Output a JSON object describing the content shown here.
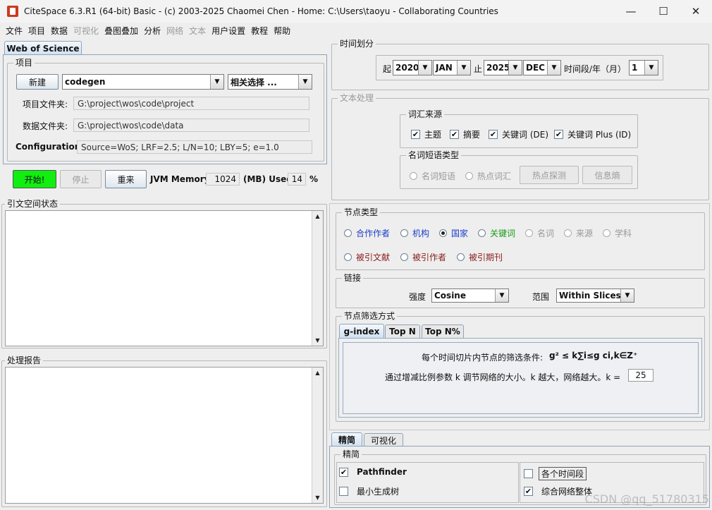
{
  "window": {
    "title": "CiteSpace 6.3.R1 (64-bit) Basic - (c) 2003-2025 Chaomei Chen - Home: C:\\Users\\taoyu - Collaborating Countries",
    "minimize": "—",
    "maximize": "☐",
    "close": "✕"
  },
  "menu": [
    "文件",
    "项目",
    "数据",
    "可视化",
    "叠图叠加",
    "分析",
    "网络",
    "文本",
    "用户设置",
    "教程",
    "帮助"
  ],
  "left": {
    "tab": "Web of Science",
    "project_group": "项目",
    "new_button": "新建",
    "project_name": "codegen",
    "related_select": "相关选择 ...",
    "project_folder_label": "项目文件夹:",
    "project_folder": "G:\\project\\wos\\code\\project",
    "data_folder_label": "数据文件夹:",
    "data_folder": "G:\\project\\wos\\code\\data",
    "config_label": "Configuration:",
    "config_value": "Source=WoS; LRF=2.5; L/N=10; LBY=5; e=1.0",
    "start_button": "开始!",
    "stop_button": "停止",
    "reset_button": "重来",
    "jvm_label": "JVM Memory",
    "jvm_value": "1024",
    "mb_used_label": "(MB) Used",
    "used_value": "14",
    "percent": "%",
    "citation_status": "引文空间状态",
    "process_report": "处理报告"
  },
  "time": {
    "group": "时间划分",
    "from_label": "起",
    "from_year": "2020",
    "from_month": "JAN",
    "to_label": "止",
    "to_year": "2025",
    "to_month": "DEC",
    "slice_label": "时间段/年（月）",
    "slice_value": "1"
  },
  "text_processing": {
    "group": "文本处理",
    "term_source_group": "词汇来源",
    "sources": [
      "主题",
      "摘要",
      "关键词 (DE)",
      "关键词 Plus (ID)"
    ],
    "noun_phrase_group": "名词短语类型",
    "noun_phrase": "名词短语",
    "burst_terms": "热点词汇",
    "burst_detect": "热点探测",
    "entropy": "信息熵"
  },
  "node_types": {
    "group": "节点类型",
    "row1": [
      "合作作者",
      "机构",
      "国家",
      "关键词",
      "名词",
      "来源",
      "学科"
    ],
    "row2": [
      "被引文献",
      "被引作者",
      "被引期刊"
    ]
  },
  "links": {
    "group": "链接",
    "strength_label": "强度",
    "strength_value": "Cosine",
    "scope_label": "范围",
    "scope_value": "Within Slices"
  },
  "selection": {
    "group": "节点筛选方式",
    "tabs": [
      "g-index",
      "Top N",
      "Top N%"
    ],
    "criterion_text": "每个时间切片内节点的筛选条件:",
    "formula": "g² ≤ k∑i≤g ci,k∈Z⁺",
    "k_text": "通过增减比例参数 k 调节网络的大小。k 越大，网络越大。k =",
    "k_value": "25"
  },
  "bottom": {
    "tabs": [
      "精简",
      "可视化"
    ],
    "group": "精简",
    "pathfinder": "Pathfinder",
    "mst": "最小生成树",
    "each_slice": "各个时间段",
    "merged": "综合网络整体"
  },
  "watermark": "CSDN @qq_51780315"
}
